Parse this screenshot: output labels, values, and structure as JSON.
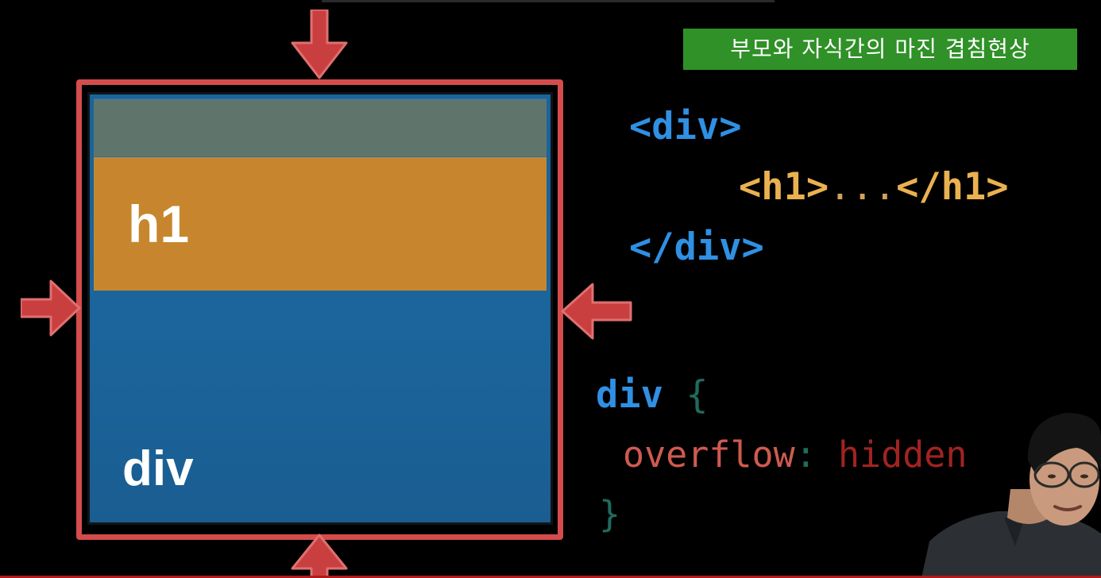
{
  "caption": {
    "text": "부모와 자식간의 마진 겹침현상",
    "background": "#2f9127"
  },
  "box_labels": {
    "h1": "h1",
    "div": "div"
  },
  "colors": {
    "red_border": "#d44c4c",
    "div_fill": "#1b659c",
    "h1_fill": "#c7862e",
    "margin_fill": "#5f756c",
    "code_blue": "#2f90e4",
    "code_gold": "#e9b14f"
  },
  "html_code": {
    "open_div_lt": "<",
    "open_div_name": "div",
    "open_div_gt": ">",
    "h1_open_lt": "<",
    "h1_open_name": "h1",
    "h1_open_gt": ">",
    "h1_content": "...",
    "h1_close_lt": "</",
    "h1_close_name": "h1",
    "h1_close_gt": ">",
    "close_div_lt": "</",
    "close_div_name": "div",
    "close_div_gt": ">"
  },
  "css_code": {
    "selector": "div",
    "open_brace": "{",
    "property": "overflow",
    "colon": ":",
    "value": "hidden",
    "close_brace": "}"
  },
  "icons": [
    "arrow-down-icon",
    "arrow-right-icon",
    "arrow-left-icon",
    "arrow-up-icon"
  ]
}
